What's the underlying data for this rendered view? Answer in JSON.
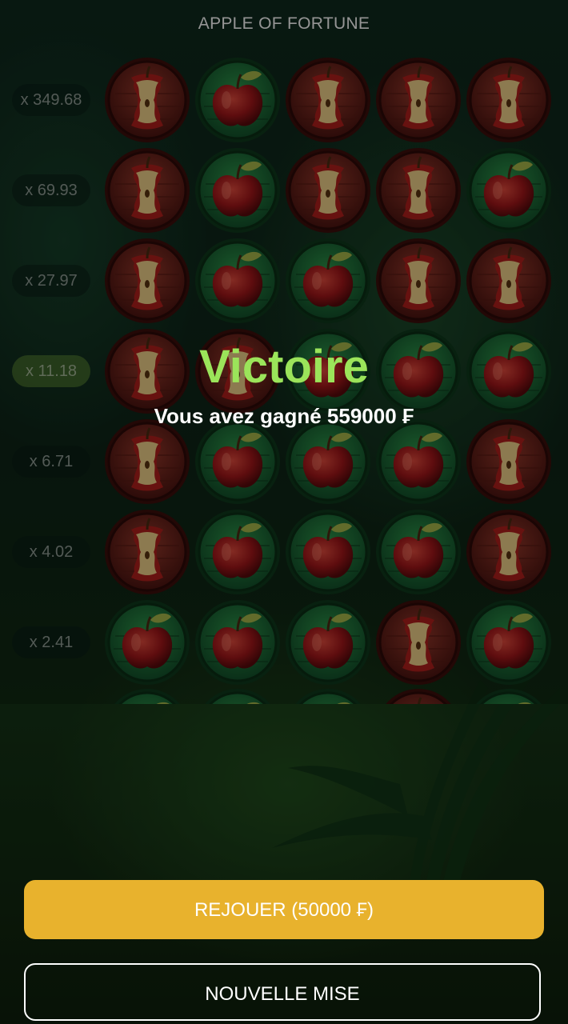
{
  "header": {
    "title": "APPLE OF FORTUNE"
  },
  "multipliers": [
    "x 349.68",
    "x 69.93",
    "x 27.97",
    "x 11.18",
    "x 6.71",
    "x 4.02",
    "x 2.41"
  ],
  "active_multiplier": "x 11.18",
  "board": [
    [
      "bitten",
      "apple",
      "bitten",
      "bitten",
      "bitten"
    ],
    [
      "bitten",
      "apple",
      "bitten",
      "bitten",
      "apple"
    ],
    [
      "bitten",
      "apple",
      "apple",
      "bitten",
      "bitten"
    ],
    [
      "bitten",
      "bitten",
      "apple",
      "apple",
      "apple"
    ],
    [
      "bitten",
      "apple",
      "apple",
      "apple",
      "bitten"
    ],
    [
      "bitten",
      "apple",
      "apple",
      "apple",
      "bitten"
    ],
    [
      "apple",
      "apple",
      "apple",
      "bitten",
      "apple"
    ]
  ],
  "result": {
    "title": "Victoire",
    "message": "Vous avez gagné 559000 ₣"
  },
  "actions": {
    "replay_label": "REJOUER (50000 ₣)",
    "new_bet_label": "NOUVELLE MISE"
  },
  "colors": {
    "accent_gold": "#e8b22d",
    "win_green": "#9be45a",
    "tile_green": "#1c6b34",
    "tile_red": "#6b1f1a"
  },
  "icons": {
    "apple": "red-apple-icon",
    "bitten": "apple-core-icon"
  }
}
